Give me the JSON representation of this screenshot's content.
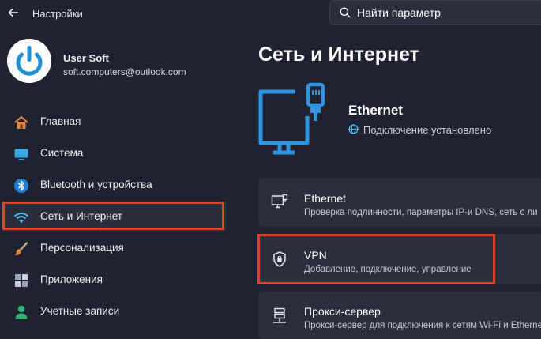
{
  "window": {
    "title": "Настройки"
  },
  "search": {
    "placeholder": "Найти параметр"
  },
  "user": {
    "name": "User Soft",
    "email": "soft.computers@outlook.com"
  },
  "sidebar": {
    "items": [
      {
        "label": "Главная",
        "icon": "home-icon"
      },
      {
        "label": "Система",
        "icon": "system-monitor-icon"
      },
      {
        "label": "Bluetooth и устройства",
        "icon": "bluetooth-icon"
      },
      {
        "label": "Сеть и Интернет",
        "icon": "wifi-icon",
        "selected": true
      },
      {
        "label": "Персонализация",
        "icon": "brush-icon"
      },
      {
        "label": "Приложения",
        "icon": "apps-icon"
      },
      {
        "label": "Учетные записи",
        "icon": "account-icon"
      }
    ]
  },
  "main": {
    "title": "Сеть и Интернет",
    "hero": {
      "title": "Ethernet",
      "status": "Подключение установлено"
    },
    "cards": [
      {
        "title": "Ethernet",
        "subtitle": "Проверка подлинности, параметры IP-и DNS, сеть с ли",
        "icon": "ethernet-icon"
      },
      {
        "title": "VPN",
        "subtitle": "Добавление, подключение, управление",
        "icon": "vpn-shield-icon"
      },
      {
        "title": "Прокси-сервер",
        "subtitle": "Прокси-сервер для подключения к сетям Wi-Fi и Etherne",
        "icon": "proxy-icon"
      }
    ]
  },
  "colors": {
    "accent": "#4cc2ff",
    "highlight": "#e0402c",
    "background": "#1f2230",
    "card": "#2b2e3d"
  }
}
